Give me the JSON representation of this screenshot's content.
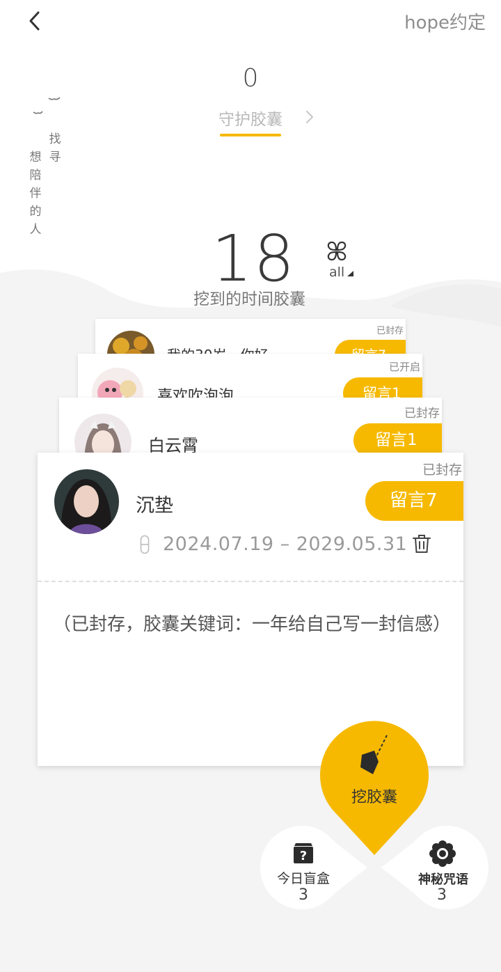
{
  "header": {
    "title": "hope约定"
  },
  "guard": {
    "count": "0",
    "label": "守护胶囊"
  },
  "poem": {
    "col1": [
      "找",
      "寻"
    ],
    "col2": [
      "想",
      "陪",
      "伴",
      "的",
      "人"
    ]
  },
  "dug": {
    "count": "18",
    "label": "挖到的时间胶囊",
    "filter": "all"
  },
  "cards": [
    {
      "name": "我的30岁，你好",
      "status": "已封存",
      "message": "留言7"
    },
    {
      "name": "喜欢吹泡泡",
      "status": "已开启",
      "message": "留言1"
    },
    {
      "name": "白云霄",
      "status": "已封存",
      "message": "留言1"
    },
    {
      "name": "沉垫",
      "status": "已封存",
      "message": "留言7",
      "dates": "2024.07.19 – 2029.05.31",
      "content": "（已封存，胶囊关键词：一年给自己写一封信感）"
    }
  ],
  "actions": {
    "dig": "挖胶囊",
    "blind_box": {
      "label": "今日盲盒",
      "count": "3"
    },
    "spell": {
      "label": "神秘咒语",
      "count": "3"
    }
  },
  "colors": {
    "accent": "#f6b900",
    "background_grey": "#f4f4f4"
  }
}
